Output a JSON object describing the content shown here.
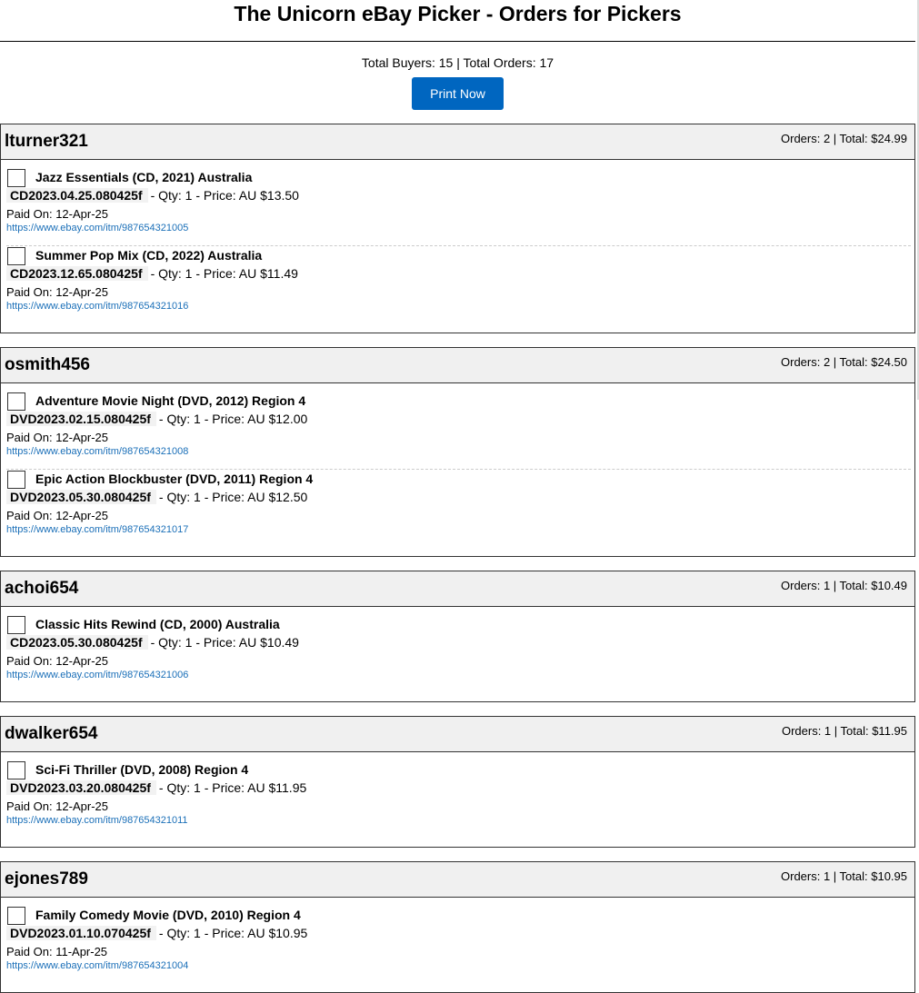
{
  "page": {
    "title": "The Unicorn eBay Picker - Orders for Pickers",
    "summary": "Total Buyers: 15 | Total Orders: 17",
    "print_label": "Print Now"
  },
  "colors": {
    "accent": "#0066c0",
    "header_bg": "#f0f0f0",
    "link": "#1a6fb8"
  },
  "buyers": [
    {
      "name": "lturner321",
      "stats": "Orders: 2 | Total: $24.99",
      "orders": [
        {
          "title": "Jazz Essentials (CD, 2021) Australia",
          "sku": "CD2023.04.25.080425f",
          "detail": "- Qty: 1 - Price: AU $13.50",
          "paid": "Paid On: 12-Apr-25",
          "link": "https://www.ebay.com/itm/987654321005"
        },
        {
          "title": "Summer Pop Mix (CD, 2022) Australia",
          "sku": "CD2023.12.65.080425f",
          "detail": "- Qty: 1 - Price: AU $11.49",
          "paid": "Paid On: 12-Apr-25",
          "link": "https://www.ebay.com/itm/987654321016"
        }
      ]
    },
    {
      "name": "osmith456",
      "stats": "Orders: 2 | Total: $24.50",
      "orders": [
        {
          "title": "Adventure Movie Night (DVD, 2012) Region 4",
          "sku": "DVD2023.02.15.080425f",
          "detail": "- Qty: 1 - Price: AU $12.00",
          "paid": "Paid On: 12-Apr-25",
          "link": "https://www.ebay.com/itm/987654321008"
        },
        {
          "title": "Epic Action Blockbuster (DVD, 2011) Region 4",
          "sku": "DVD2023.05.30.080425f",
          "detail": "- Qty: 1 - Price: AU $12.50",
          "paid": "Paid On: 12-Apr-25",
          "link": "https://www.ebay.com/itm/987654321017"
        }
      ]
    },
    {
      "name": "achoi654",
      "stats": "Orders: 1 | Total: $10.49",
      "orders": [
        {
          "title": "Classic Hits Rewind (CD, 2000) Australia",
          "sku": "CD2023.05.30.080425f",
          "detail": "- Qty: 1 - Price: AU $10.49",
          "paid": "Paid On: 12-Apr-25",
          "link": "https://www.ebay.com/itm/987654321006"
        }
      ]
    },
    {
      "name": "dwalker654",
      "stats": "Orders: 1 | Total: $11.95",
      "orders": [
        {
          "title": "Sci-Fi Thriller (DVD, 2008) Region 4",
          "sku": "DVD2023.03.20.080425f",
          "detail": "- Qty: 1 - Price: AU $11.95",
          "paid": "Paid On: 12-Apr-25",
          "link": "https://www.ebay.com/itm/987654321011"
        }
      ]
    },
    {
      "name": "ejones789",
      "stats": "Orders: 1 | Total: $10.95",
      "orders": [
        {
          "title": "Family Comedy Movie (DVD, 2010) Region 4",
          "sku": "DVD2023.01.10.070425f",
          "detail": "- Qty: 1 - Price: AU $10.95",
          "paid": "Paid On: 11-Apr-25",
          "link": "https://www.ebay.com/itm/987654321004"
        }
      ]
    }
  ]
}
